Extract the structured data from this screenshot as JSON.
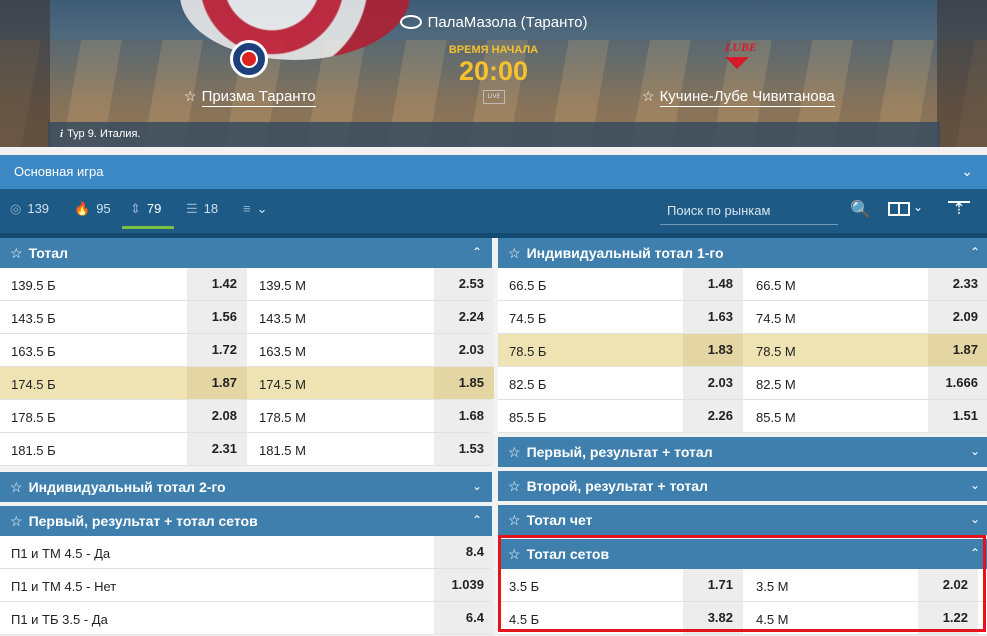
{
  "header": {
    "venue": "ПалаМазола (Таранто)",
    "start_label": "ВРЕМЯ НАЧАЛА",
    "start_time": "20:00",
    "live_badge": "LIVE",
    "team1": "Призма Таранто",
    "team2": "Кучине-Лубе Чивитанова",
    "team2_logo_text": "LUBE",
    "tour": "Тур 9. Италия.",
    "info_icon": "i"
  },
  "game_selector": {
    "label": "Основная игра",
    "chevron": "⌄"
  },
  "toolbar": {
    "tabs": [
      {
        "icon": "◎",
        "count": "139"
      },
      {
        "icon": "🔥",
        "count": "95"
      },
      {
        "icon": "⇕",
        "count": "79"
      },
      {
        "icon": "☰",
        "count": "18"
      },
      {
        "icon": "≡",
        "count": "⌄"
      }
    ],
    "search_placeholder": "Поиск по рынкам",
    "search_icon": "🔍",
    "cols_chevron": "⌄",
    "upload_icon": "⇡"
  },
  "markets_left": {
    "total": {
      "title": "Тотал",
      "rows": [
        {
          "l": "139.5 Б",
          "lo": "1.42",
          "r": "139.5 М",
          "ro": "2.53"
        },
        {
          "l": "143.5 Б",
          "lo": "1.56",
          "r": "143.5 М",
          "ro": "2.24"
        },
        {
          "l": "163.5 Б",
          "lo": "1.72",
          "r": "163.5 М",
          "ro": "2.03"
        },
        {
          "l": "174.5 Б",
          "lo": "1.87",
          "r": "174.5 М",
          "ro": "1.85"
        },
        {
          "l": "178.5 Б",
          "lo": "2.08",
          "r": "178.5 М",
          "ro": "1.68"
        },
        {
          "l": "181.5 Б",
          "lo": "2.31",
          "r": "181.5 М",
          "ro": "1.53"
        }
      ]
    },
    "ind_total_2": {
      "title": "Индивидуальный тотал 2-го"
    },
    "first_result_sets": {
      "title": "Первый, результат + тотал сетов",
      "rows": [
        {
          "l": "П1 и ТМ 4.5 - Да",
          "o": "8.4"
        },
        {
          "l": "П1 и ТМ 4.5 - Нет",
          "o": "1.039"
        },
        {
          "l": "П1 и ТБ 3.5 - Да",
          "o": "6.4"
        }
      ]
    }
  },
  "markets_right": {
    "ind_total_1": {
      "title": "Индивидуальный тотал 1-го",
      "rows": [
        {
          "l": "66.5 Б",
          "lo": "1.48",
          "r": "66.5 М",
          "ro": "2.33"
        },
        {
          "l": "74.5 Б",
          "lo": "1.63",
          "r": "74.5 М",
          "ro": "2.09"
        },
        {
          "l": "78.5 Б",
          "lo": "1.83",
          "r": "78.5 М",
          "ro": "1.87"
        },
        {
          "l": "82.5 Б",
          "lo": "2.03",
          "r": "82.5 М",
          "ro": "1.666"
        },
        {
          "l": "85.5 Б",
          "lo": "2.26",
          "r": "85.5 М",
          "ro": "1.51"
        }
      ]
    },
    "first_result_total": {
      "title": "Первый, результат + тотал"
    },
    "second_result_total": {
      "title": "Второй, результат + тотал"
    },
    "total_even": {
      "title": "Тотал чет"
    },
    "total_sets": {
      "title": "Тотал сетов",
      "rows": [
        {
          "l": "3.5 Б",
          "lo": "1.71",
          "r": "3.5 М",
          "ro": "2.02"
        },
        {
          "l": "4.5 Б",
          "lo": "3.82",
          "r": "4.5 М",
          "ro": "1.22"
        }
      ]
    }
  },
  "icons": {
    "star": "☆",
    "chev_up": "⌃",
    "chev_down": "⌄"
  },
  "colors": {
    "accent_yellow": "#f5c12f",
    "header_blue": "#3e7fae",
    "highlight_row": "#efe3b4",
    "callout_red": "#e3141c",
    "active_green": "#7bc043"
  }
}
